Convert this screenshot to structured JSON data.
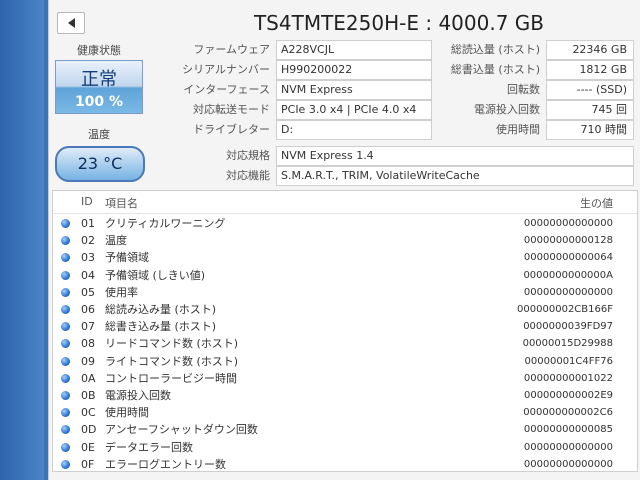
{
  "title": "TS4TMTE250H-E : 4000.7 GB",
  "health": {
    "label": "健康状態",
    "status": "正常",
    "percent": "100 %"
  },
  "temperature": {
    "label": "温度",
    "value": "23 °C"
  },
  "info_left": [
    {
      "label": "ファームウェア",
      "value": "A228VCJL"
    },
    {
      "label": "シリアルナンバー",
      "value": "H990200022"
    },
    {
      "label": "インターフェース",
      "value": "NVM Express"
    },
    {
      "label": "対応転送モード",
      "value": "PCIe 3.0 x4 | PCIe 4.0 x4"
    },
    {
      "label": "ドライブレター",
      "value": "D:"
    }
  ],
  "info_right": [
    {
      "label": "総読込量 (ホスト)",
      "value": "22346 GB"
    },
    {
      "label": "総書込量 (ホスト)",
      "value": "1812 GB"
    },
    {
      "label": "回転数",
      "value": "---- (SSD)"
    },
    {
      "label": "電源投入回数",
      "value": "745 回"
    },
    {
      "label": "使用時間",
      "value": "710 時間"
    }
  ],
  "standard": {
    "label": "対応規格",
    "value": "NVM Express 1.4"
  },
  "features": {
    "label": "対応機能",
    "value": "S.M.A.R.T., TRIM, VolatileWriteCache"
  },
  "smart_header": {
    "id": "ID",
    "name": "項目名",
    "raw": "生の値"
  },
  "smart_rows": [
    {
      "id": "01",
      "name": "クリティカルワーニング",
      "raw": "00000000000000"
    },
    {
      "id": "02",
      "name": "温度",
      "raw": "00000000000128"
    },
    {
      "id": "03",
      "name": "予備領域",
      "raw": "00000000000064"
    },
    {
      "id": "04",
      "name": "予備領域 (しきい値)",
      "raw": "0000000000000A"
    },
    {
      "id": "05",
      "name": "使用率",
      "raw": "00000000000000"
    },
    {
      "id": "06",
      "name": "総読み込み量 (ホスト)",
      "raw": "000000002CB166F"
    },
    {
      "id": "07",
      "name": "総書き込み量 (ホスト)",
      "raw": "0000000039FD97"
    },
    {
      "id": "08",
      "name": "リードコマンド数 (ホスト)",
      "raw": "00000015D29988"
    },
    {
      "id": "09",
      "name": "ライトコマンド数 (ホスト)",
      "raw": "00000001C4FF76"
    },
    {
      "id": "0A",
      "name": "コントローラービジー時間",
      "raw": "00000000001022"
    },
    {
      "id": "0B",
      "name": "電源投入回数",
      "raw": "000000000002E9"
    },
    {
      "id": "0C",
      "name": "使用時間",
      "raw": "000000000002C6"
    },
    {
      "id": "0D",
      "name": "アンセーフシャットダウン回数",
      "raw": "00000000000085"
    },
    {
      "id": "0E",
      "name": "データエラー回数",
      "raw": "00000000000000"
    },
    {
      "id": "0F",
      "name": "エラーログエントリー数",
      "raw": "00000000000000"
    }
  ]
}
